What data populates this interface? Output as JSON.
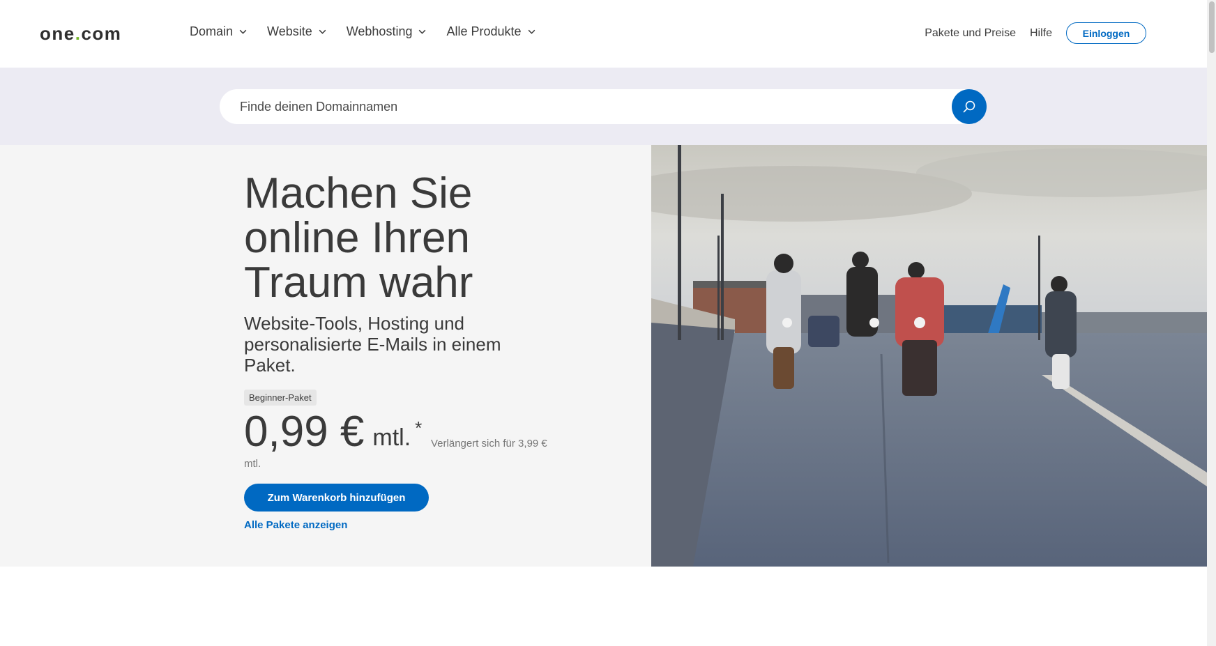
{
  "header": {
    "logo_text_left": "one",
    "logo_dot": ".",
    "logo_text_right": "com",
    "nav": [
      {
        "label": "Domain"
      },
      {
        "label": "Website"
      },
      {
        "label": "Webhosting"
      },
      {
        "label": "Alle Produkte"
      }
    ],
    "links": {
      "pricing": "Pakete und Preise",
      "help": "Hilfe"
    },
    "login_label": "Einloggen"
  },
  "search": {
    "placeholder": "Finde deinen Domainnamen",
    "icon": "search-icon"
  },
  "hero": {
    "title": "Machen Sie online Ihren Traum wahr",
    "subtitle": "Website-Tools, Hosting und personalisierte E-Mails in einem Paket.",
    "badge": "Beginner-Paket",
    "price": "0,99 €",
    "per": "mtl.",
    "asterisk": "*",
    "renewal": "Verlängert sich für 3,99 € mtl.",
    "cta": "Zum Warenkorb hinzufügen",
    "all_packages": "Alle Pakete anzeigen"
  },
  "colors": {
    "accent": "#0069c2",
    "logo_dot": "#76b82a",
    "search_band": "#ecebf3",
    "hero_bg": "#f5f5f5"
  }
}
